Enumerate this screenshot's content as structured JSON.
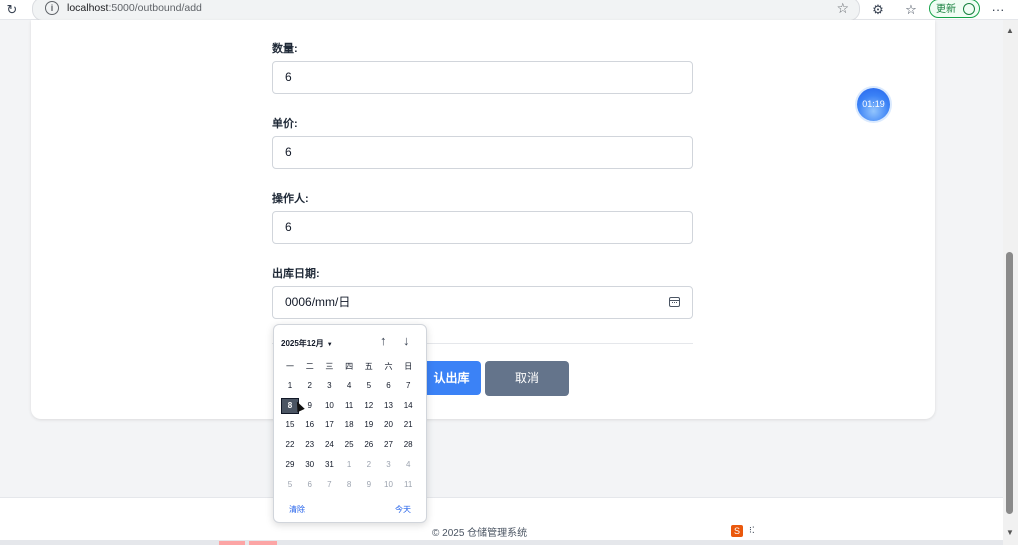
{
  "browser": {
    "url_host": "localhost",
    "url_path": ":5000/outbound/add",
    "update_label": "更新"
  },
  "form": {
    "quantity": {
      "label": "数量:",
      "value": "6"
    },
    "unit_price": {
      "label": "单价:",
      "value": "6"
    },
    "operator": {
      "label": "操作人:",
      "value": "6"
    },
    "outbound_date": {
      "label": "出库日期:",
      "value": "0006/mm/日"
    },
    "submit_label": "确认出库",
    "submit_visible": "认出库",
    "cancel_label": "取消"
  },
  "timer": "01:19",
  "footer": "© 2025 仓储管理系统",
  "datepicker": {
    "month_title": "2025年12月",
    "weekdays": [
      "一",
      "二",
      "三",
      "四",
      "五",
      "六",
      "日"
    ],
    "weeks": [
      [
        "1",
        "2",
        "3",
        "4",
        "5",
        "6",
        "7"
      ],
      [
        "8",
        "9",
        "10",
        "11",
        "12",
        "13",
        "14"
      ],
      [
        "15",
        "16",
        "17",
        "18",
        "19",
        "20",
        "21"
      ],
      [
        "22",
        "23",
        "24",
        "25",
        "26",
        "27",
        "28"
      ],
      [
        "29",
        "30",
        "31",
        "1",
        "2",
        "3",
        "4"
      ],
      [
        "5",
        "6",
        "7",
        "8",
        "9",
        "10",
        "11"
      ]
    ],
    "muted_from": [
      [
        4,
        3
      ],
      [
        5,
        0
      ]
    ],
    "selected": "8",
    "clear_label": "清除",
    "today_label": "今天"
  }
}
